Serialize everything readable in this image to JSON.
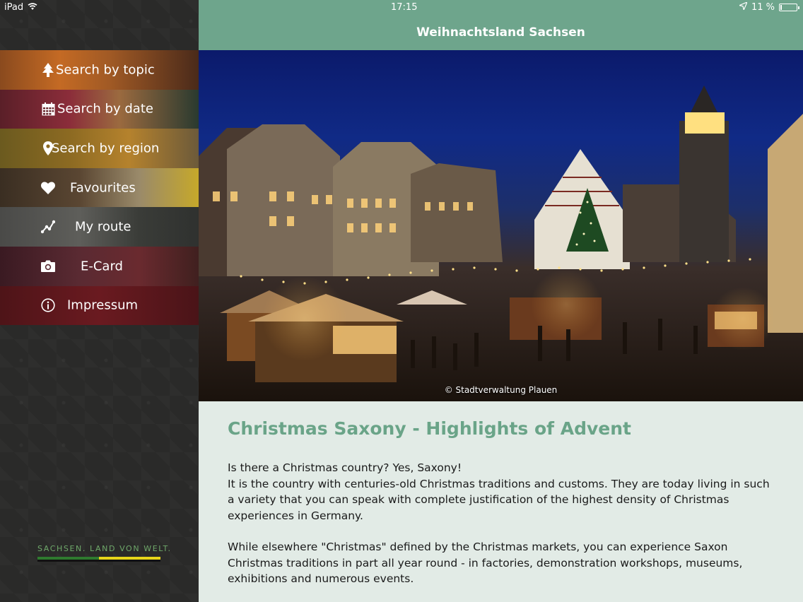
{
  "status_bar": {
    "device": "iPad",
    "time": "17:15",
    "battery": "11 %",
    "battery_level": 0.11
  },
  "header": {
    "title": "Weihnachtsland Sachsen"
  },
  "sidebar": {
    "items": [
      {
        "label": "Search by topic",
        "icon": "tree-icon"
      },
      {
        "label": "Search by date",
        "icon": "calendar-icon"
      },
      {
        "label": "Search by region",
        "icon": "map-pin-icon"
      },
      {
        "label": "Favourites",
        "icon": "heart-icon"
      },
      {
        "label": "My route",
        "icon": "route-icon"
      },
      {
        "label": "E-Card",
        "icon": "camera-icon"
      },
      {
        "label": "Impressum",
        "icon": "info-icon"
      }
    ],
    "brand": "SACHSEN. LAND VON WELT."
  },
  "hero": {
    "credit": "© Stadtverwaltung Plauen"
  },
  "article": {
    "title": "Christmas Saxony - Highlights of Advent",
    "paragraph1": "Is there a Christmas country? Yes, Saxony!\nIt is the country with centuries-old Christmas traditions and customs. They are today living in such a variety that you can speak with complete justification of the highest density of Christmas experiences in Germany.",
    "paragraph2": "While elsewhere \"Christmas\" defined by the Christmas markets, you can experience Saxon Christmas traditions in part all year round - in factories, demonstration workshops, museums, exhibitions and numerous events."
  }
}
